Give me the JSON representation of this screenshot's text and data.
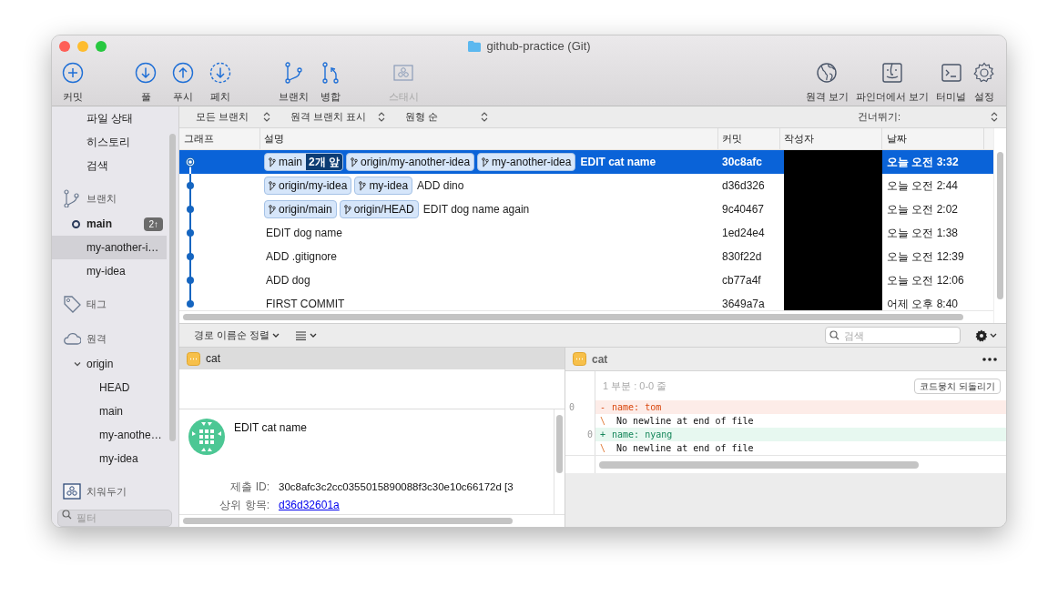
{
  "window": {
    "title": "github-practice (Git)"
  },
  "toolbar": {
    "groups": [
      {
        "items": [
          {
            "label": "커밋",
            "disabled": false
          }
        ]
      },
      {
        "items": [
          {
            "label": "풀",
            "disabled": false
          },
          {
            "label": "푸시",
            "disabled": false
          },
          {
            "label": "페치",
            "disabled": false
          }
        ]
      },
      {
        "items": [
          {
            "label": "브랜치",
            "disabled": false
          },
          {
            "label": "병합",
            "disabled": false
          }
        ]
      },
      {
        "items": [
          {
            "label": "스태시",
            "disabled": true
          }
        ]
      }
    ],
    "right": [
      {
        "label": "원격 보기"
      },
      {
        "label": "파인더에서 보기"
      },
      {
        "label": "터미널"
      },
      {
        "label": "설정"
      }
    ]
  },
  "sidebar": {
    "workspace": [
      {
        "label": "파일 상태",
        "selected": false
      },
      {
        "label": "히스토리",
        "selected": false
      },
      {
        "label": "검색",
        "selected": false
      }
    ],
    "sections": [
      {
        "kind": "branches",
        "label": "브랜치",
        "items": [
          {
            "label": "main",
            "current": true,
            "badge": "2↑",
            "selected": false
          },
          {
            "label": "my-another-i…",
            "current": false,
            "selected": true
          },
          {
            "label": "my-idea",
            "current": false,
            "selected": false
          }
        ]
      },
      {
        "kind": "tags",
        "label": "태그"
      },
      {
        "kind": "remotes",
        "label": "원격",
        "items": [
          {
            "label": "origin",
            "expanded": true,
            "children": [
              {
                "label": "HEAD"
              },
              {
                "label": "main"
              },
              {
                "label": "my-anothe…"
              },
              {
                "label": "my-idea"
              }
            ]
          }
        ]
      },
      {
        "kind": "stashes",
        "label": "치워두기"
      }
    ],
    "filter": {
      "placeholder": "필터"
    }
  },
  "log": {
    "filters": [
      "모든 브랜치",
      "원격 브랜치 표시",
      "원형 순"
    ],
    "jump": "건너뛰기:",
    "columns": [
      "그래프",
      "설명",
      "커밋",
      "작성자",
      "날짜"
    ],
    "rows": [
      {
        "refs": [
          {
            "label": "main",
            "ahead": "2개 앞"
          },
          {
            "label": "origin/my-another-idea"
          },
          {
            "label": "my-another-idea"
          }
        ],
        "message": "EDIT cat name",
        "commit": "30c8afc",
        "redacted": true,
        "date": "오늘 오전 3:32",
        "selected": true
      },
      {
        "refs": [
          {
            "label": "origin/my-idea"
          },
          {
            "label": "my-idea"
          }
        ],
        "message": "ADD dino",
        "commit": "d36d326",
        "redacted": true,
        "date": "오늘 오전 2:44",
        "selected": false
      },
      {
        "refs": [
          {
            "label": "origin/main"
          },
          {
            "label": "origin/HEAD"
          }
        ],
        "message": "EDIT dog name again",
        "commit": "9c40467",
        "redacted": true,
        "date": "오늘 오전 2:02",
        "selected": false
      },
      {
        "message": "EDIT dog name",
        "commit": "1ed24e4",
        "redacted": true,
        "date": "오늘 오전 1:38",
        "selected": false
      },
      {
        "message": "ADD .gitignore",
        "commit": "830f22d",
        "redacted": true,
        "date": "오늘 오전 12:39",
        "selected": false
      },
      {
        "message": "ADD dog",
        "commit": "cb77a4f",
        "redacted": true,
        "date": "오늘 오전 12:06",
        "selected": false
      },
      {
        "message": "FIRST COMMIT",
        "commit": "3649a7a",
        "redacted": true,
        "date": "어제 오후 8:40",
        "selected": false
      }
    ]
  },
  "details": {
    "sort": "경로 이름순 정렬",
    "search": {
      "placeholder": "검색"
    },
    "files": [
      {
        "name": "cat",
        "selected": true
      }
    ],
    "commit": {
      "message": "EDIT cat name",
      "fields": [
        {
          "label": "제출 ID:",
          "value": "30c8afc3c2cc0355015890088f3c30e10c66172d [3",
          "kind": "text"
        },
        {
          "label": "상위 항목:",
          "value": "d36d32601a",
          "kind": "link"
        }
      ]
    }
  },
  "diff": {
    "file": "cat",
    "hunk": "1 부분 : 0-0 줄",
    "revert": "코드뭉치 되돌리기",
    "lines": [
      {
        "kind": "removed",
        "old": "0",
        "sign": "-",
        "text": "name: tom"
      },
      {
        "kind": "note",
        "sign": "\\",
        "text": "No newline at end of file"
      },
      {
        "kind": "added",
        "new": "0",
        "sign": "+",
        "text": "name: nyang"
      },
      {
        "kind": "note",
        "sign": "\\",
        "text": "No newline at end of file"
      }
    ]
  }
}
